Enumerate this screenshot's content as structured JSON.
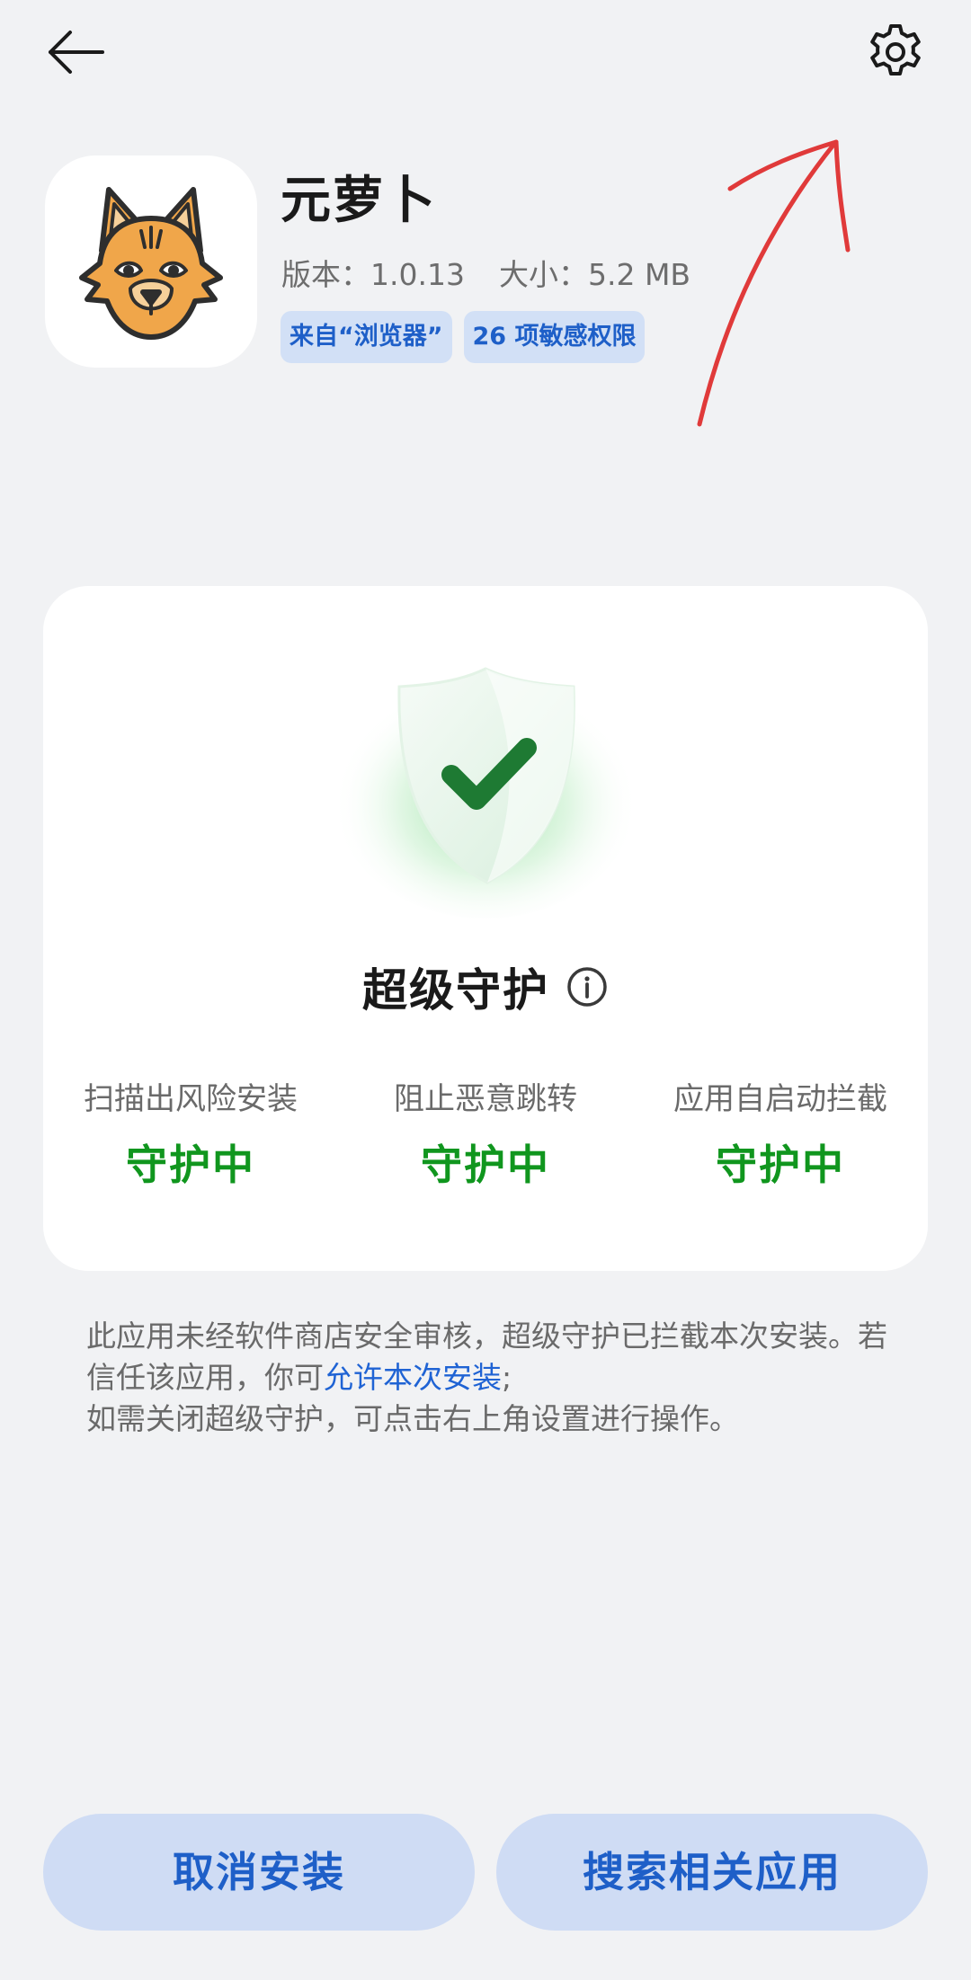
{
  "header": {
    "back_icon": "arrow-left-icon",
    "settings_icon": "gear-icon"
  },
  "app": {
    "name": "元萝卜",
    "version_label": "版本：",
    "version": "1.0.13",
    "size_label": "大小：",
    "size": "5.2 MB",
    "tags": [
      "来自“浏览器”",
      "26 项敏感权限"
    ],
    "icon": "lynx-face-icon"
  },
  "protection": {
    "title": "超级守护",
    "info_icon": "info-icon",
    "shield_icon": "shield-check-icon",
    "features": [
      {
        "label": "扫描出风险安装",
        "status": "守护中"
      },
      {
        "label": "阻止恶意跳转",
        "status": "守护中"
      },
      {
        "label": "应用自启动拦截",
        "status": "守护中"
      }
    ]
  },
  "notice": {
    "line1": "此应用未经软件商店安全审核，超级守护已拦截本次安装。若信任该应用，你可",
    "link": "允许本次安装",
    "line1_end": ";",
    "line2": "如需关闭超级守护，可点击右上角设置进行操作。"
  },
  "buttons": {
    "cancel": "取消安装",
    "search": "搜索相关应用"
  },
  "colors": {
    "background": "#f1f2f4",
    "accent_blue": "#1e5fc8",
    "status_green": "#10961e",
    "annotation_red": "#e03a3a"
  }
}
